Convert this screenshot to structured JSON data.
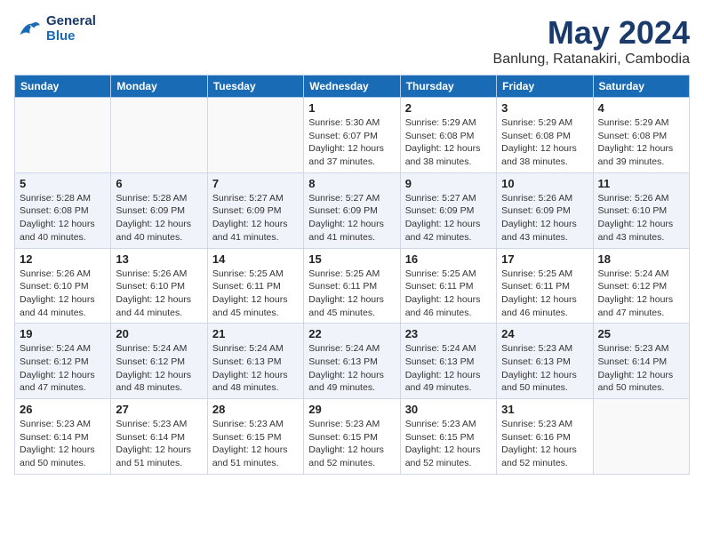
{
  "header": {
    "logo_line1": "General",
    "logo_line2": "Blue",
    "month": "May 2024",
    "location": "Banlung, Ratanakiri, Cambodia"
  },
  "weekdays": [
    "Sunday",
    "Monday",
    "Tuesday",
    "Wednesday",
    "Thursday",
    "Friday",
    "Saturday"
  ],
  "weeks": [
    [
      {
        "day": "",
        "info": ""
      },
      {
        "day": "",
        "info": ""
      },
      {
        "day": "",
        "info": ""
      },
      {
        "day": "1",
        "info": "Sunrise: 5:30 AM\nSunset: 6:07 PM\nDaylight: 12 hours\nand 37 minutes."
      },
      {
        "day": "2",
        "info": "Sunrise: 5:29 AM\nSunset: 6:08 PM\nDaylight: 12 hours\nand 38 minutes."
      },
      {
        "day": "3",
        "info": "Sunrise: 5:29 AM\nSunset: 6:08 PM\nDaylight: 12 hours\nand 38 minutes."
      },
      {
        "day": "4",
        "info": "Sunrise: 5:29 AM\nSunset: 6:08 PM\nDaylight: 12 hours\nand 39 minutes."
      }
    ],
    [
      {
        "day": "5",
        "info": "Sunrise: 5:28 AM\nSunset: 6:08 PM\nDaylight: 12 hours\nand 40 minutes."
      },
      {
        "day": "6",
        "info": "Sunrise: 5:28 AM\nSunset: 6:09 PM\nDaylight: 12 hours\nand 40 minutes."
      },
      {
        "day": "7",
        "info": "Sunrise: 5:27 AM\nSunset: 6:09 PM\nDaylight: 12 hours\nand 41 minutes."
      },
      {
        "day": "8",
        "info": "Sunrise: 5:27 AM\nSunset: 6:09 PM\nDaylight: 12 hours\nand 41 minutes."
      },
      {
        "day": "9",
        "info": "Sunrise: 5:27 AM\nSunset: 6:09 PM\nDaylight: 12 hours\nand 42 minutes."
      },
      {
        "day": "10",
        "info": "Sunrise: 5:26 AM\nSunset: 6:09 PM\nDaylight: 12 hours\nand 43 minutes."
      },
      {
        "day": "11",
        "info": "Sunrise: 5:26 AM\nSunset: 6:10 PM\nDaylight: 12 hours\nand 43 minutes."
      }
    ],
    [
      {
        "day": "12",
        "info": "Sunrise: 5:26 AM\nSunset: 6:10 PM\nDaylight: 12 hours\nand 44 minutes."
      },
      {
        "day": "13",
        "info": "Sunrise: 5:26 AM\nSunset: 6:10 PM\nDaylight: 12 hours\nand 44 minutes."
      },
      {
        "day": "14",
        "info": "Sunrise: 5:25 AM\nSunset: 6:11 PM\nDaylight: 12 hours\nand 45 minutes."
      },
      {
        "day": "15",
        "info": "Sunrise: 5:25 AM\nSunset: 6:11 PM\nDaylight: 12 hours\nand 45 minutes."
      },
      {
        "day": "16",
        "info": "Sunrise: 5:25 AM\nSunset: 6:11 PM\nDaylight: 12 hours\nand 46 minutes."
      },
      {
        "day": "17",
        "info": "Sunrise: 5:25 AM\nSunset: 6:11 PM\nDaylight: 12 hours\nand 46 minutes."
      },
      {
        "day": "18",
        "info": "Sunrise: 5:24 AM\nSunset: 6:12 PM\nDaylight: 12 hours\nand 47 minutes."
      }
    ],
    [
      {
        "day": "19",
        "info": "Sunrise: 5:24 AM\nSunset: 6:12 PM\nDaylight: 12 hours\nand 47 minutes."
      },
      {
        "day": "20",
        "info": "Sunrise: 5:24 AM\nSunset: 6:12 PM\nDaylight: 12 hours\nand 48 minutes."
      },
      {
        "day": "21",
        "info": "Sunrise: 5:24 AM\nSunset: 6:13 PM\nDaylight: 12 hours\nand 48 minutes."
      },
      {
        "day": "22",
        "info": "Sunrise: 5:24 AM\nSunset: 6:13 PM\nDaylight: 12 hours\nand 49 minutes."
      },
      {
        "day": "23",
        "info": "Sunrise: 5:24 AM\nSunset: 6:13 PM\nDaylight: 12 hours\nand 49 minutes."
      },
      {
        "day": "24",
        "info": "Sunrise: 5:23 AM\nSunset: 6:13 PM\nDaylight: 12 hours\nand 50 minutes."
      },
      {
        "day": "25",
        "info": "Sunrise: 5:23 AM\nSunset: 6:14 PM\nDaylight: 12 hours\nand 50 minutes."
      }
    ],
    [
      {
        "day": "26",
        "info": "Sunrise: 5:23 AM\nSunset: 6:14 PM\nDaylight: 12 hours\nand 50 minutes."
      },
      {
        "day": "27",
        "info": "Sunrise: 5:23 AM\nSunset: 6:14 PM\nDaylight: 12 hours\nand 51 minutes."
      },
      {
        "day": "28",
        "info": "Sunrise: 5:23 AM\nSunset: 6:15 PM\nDaylight: 12 hours\nand 51 minutes."
      },
      {
        "day": "29",
        "info": "Sunrise: 5:23 AM\nSunset: 6:15 PM\nDaylight: 12 hours\nand 52 minutes."
      },
      {
        "day": "30",
        "info": "Sunrise: 5:23 AM\nSunset: 6:15 PM\nDaylight: 12 hours\nand 52 minutes."
      },
      {
        "day": "31",
        "info": "Sunrise: 5:23 AM\nSunset: 6:16 PM\nDaylight: 12 hours\nand 52 minutes."
      },
      {
        "day": "",
        "info": ""
      }
    ]
  ]
}
